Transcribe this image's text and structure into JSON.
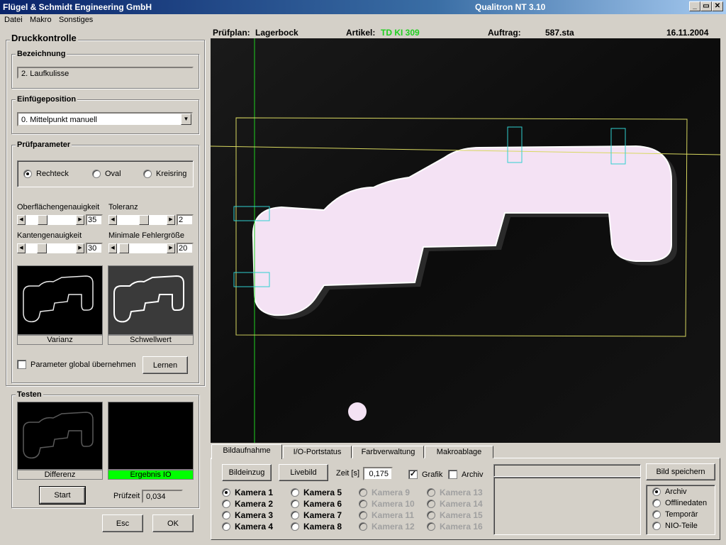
{
  "window": {
    "title_left": "Flügel & Schmidt  Engineering GmbH",
    "title_right": "Qualitron NT  3.10",
    "buttons": {
      "minimize": "_",
      "restore": "▭",
      "close": "✕"
    }
  },
  "menu": [
    "Datei",
    "Makro",
    "Sonstiges"
  ],
  "left_panel": {
    "title": "Druckkontrolle",
    "bezeichnung": {
      "legend": "Bezeichnung",
      "value": "2.  Laufkulisse"
    },
    "einfuegeposition": {
      "legend": "Einfügeposition",
      "value": "0.  Mittelpunkt manuell"
    },
    "pruefparameter": {
      "legend": "Prüfparameter",
      "shapes": [
        {
          "label": "Rechteck",
          "selected": true
        },
        {
          "label": "Oval",
          "selected": false
        },
        {
          "label": "Kreisring",
          "selected": false
        }
      ],
      "sliders": [
        {
          "label": "Oberflächengenauigkeit",
          "value": "35",
          "level": 0.3
        },
        {
          "label": "Toleranz",
          "value": "2",
          "level": 0.55
        },
        {
          "label": "Kantengenauigkeit",
          "value": "30",
          "level": 0.28
        },
        {
          "label": "Minimale Fehlergröße",
          "value": "20",
          "level": 0.06
        }
      ],
      "previews": [
        "Varianz",
        "Schwellwert"
      ],
      "global_checkbox": {
        "label": "Parameter global übernehmen",
        "checked": false
      },
      "learn_button": "Lernen"
    },
    "testen": {
      "legend": "Testen",
      "previews": [
        "Differenz",
        "Ergebnis  IO"
      ],
      "start_button": "Start",
      "pruefzeit_label": "Prüfzeit",
      "pruefzeit_value": "0,034"
    },
    "esc_button": "Esc",
    "ok_button": "OK"
  },
  "info": {
    "pruefplan_label": "Prüfplan:",
    "pruefplan_value": "Lagerbock",
    "artikel_label": "Artikel:",
    "artikel_value": "TD KI 309",
    "auftrag_label": "Auftrag:",
    "auftrag_value": "587.sta",
    "date": "16.11.2004"
  },
  "tabs": [
    "Bildaufnahme",
    "I/O-Portstatus",
    "Farbverwaltung",
    "Makroablage"
  ],
  "bottom": {
    "bildeinzug": "Bildeinzug",
    "livebild": "Livebild",
    "zeit_label": "Zeit [s]",
    "zeit_value": "0,175",
    "grafik": {
      "label": "Grafik",
      "checked": true
    },
    "archiv": {
      "label": "Archiv",
      "checked": false
    },
    "bild_speichern": "Bild speichern",
    "cameras": [
      {
        "label": "Kamera 1",
        "selected": true,
        "enabled": true
      },
      {
        "label": "Kamera 2",
        "selected": false,
        "enabled": true
      },
      {
        "label": "Kamera 3",
        "selected": false,
        "enabled": true
      },
      {
        "label": "Kamera 4",
        "selected": false,
        "enabled": true
      },
      {
        "label": "Kamera 5",
        "selected": false,
        "enabled": true
      },
      {
        "label": "Kamera 6",
        "selected": false,
        "enabled": true
      },
      {
        "label": "Kamera 7",
        "selected": false,
        "enabled": true
      },
      {
        "label": "Kamera 8",
        "selected": false,
        "enabled": true
      },
      {
        "label": "Kamera 9",
        "selected": false,
        "enabled": false
      },
      {
        "label": "Kamera 10",
        "selected": false,
        "enabled": false
      },
      {
        "label": "Kamera 11",
        "selected": false,
        "enabled": false
      },
      {
        "label": "Kamera 12",
        "selected": false,
        "enabled": false
      },
      {
        "label": "Kamera 13",
        "selected": false,
        "enabled": false
      },
      {
        "label": "Kamera 14",
        "selected": false,
        "enabled": false
      },
      {
        "label": "Kamera 15",
        "selected": false,
        "enabled": false
      },
      {
        "label": "Kamera 16",
        "selected": false,
        "enabled": false
      }
    ],
    "save_targets": [
      {
        "label": "Archiv",
        "selected": true
      },
      {
        "label": "Offlinedaten",
        "selected": false
      },
      {
        "label": "Temporär",
        "selected": false
      },
      {
        "label": "NIO-Teile",
        "selected": false
      }
    ]
  },
  "colors": {
    "accent_green": "#1fcf1f",
    "result_ok": "#00ff00",
    "overlay_yellow": "#d8d860",
    "overlay_cyan": "#30d0d0",
    "title_blue": "#0a246a"
  }
}
